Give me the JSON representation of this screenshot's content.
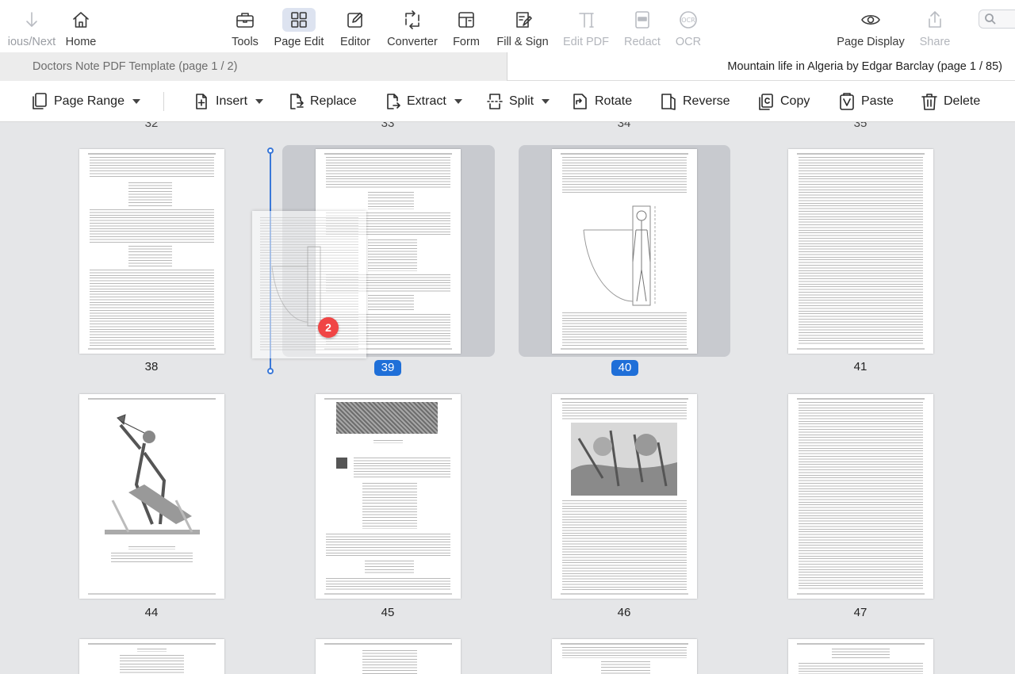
{
  "toolbar": {
    "nav_label": "ious/Next",
    "home": "Home",
    "tools": "Tools",
    "page_edit": "Page Edit",
    "editor": "Editor",
    "converter": "Converter",
    "form": "Form",
    "fill_sign": "Fill & Sign",
    "edit_pdf": "Edit PDF",
    "redact": "Redact",
    "ocr": "OCR",
    "page_display": "Page Display",
    "share": "Share"
  },
  "tabs": {
    "left": "Doctors Note PDF Template (page 1 / 2)",
    "right": "Mountain life in Algeria by Edgar Barclay (page 1 / 85)"
  },
  "page_edit_toolbar": {
    "page_range": "Page Range",
    "insert": "Insert",
    "replace": "Replace",
    "extract": "Extract",
    "split": "Split",
    "rotate": "Rotate",
    "reverse": "Reverse",
    "copy": "Copy",
    "paste": "Paste",
    "delete": "Delete"
  },
  "pages": {
    "top_row": [
      "32",
      "33",
      "34",
      "35"
    ],
    "row1": [
      "38",
      "39",
      "40",
      "41"
    ],
    "row2": [
      "44",
      "45",
      "46",
      "47"
    ],
    "selected": [
      "39",
      "40"
    ]
  },
  "drag": {
    "badge": "2"
  },
  "colors": {
    "accent": "#1f6fd8",
    "selection_bg": "#c8cacf",
    "badge": "#f04545",
    "workspace_bg": "#e5e6e8"
  }
}
